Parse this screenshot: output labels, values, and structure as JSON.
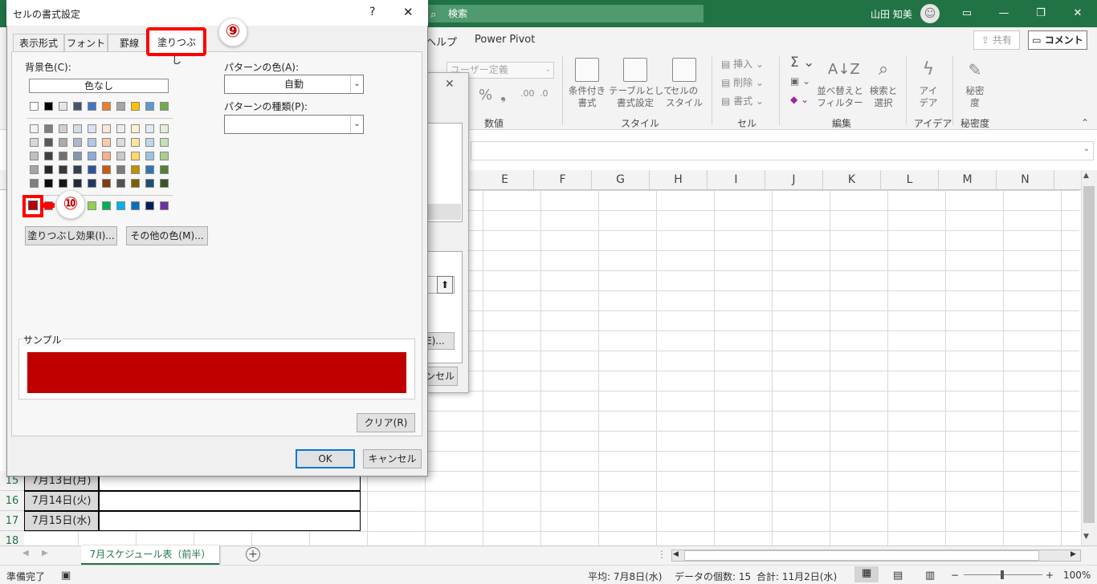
{
  "titlebar": {
    "search": "検索",
    "user": "山田 知美",
    "min": "—",
    "restore": "❐",
    "close": "✕",
    "ribbon_display": "▭"
  },
  "ribbon_tabs": {
    "help": "ヘルプ",
    "powerpivot": "Power Pivot"
  },
  "share": "共有",
  "comment": "コメント",
  "ribbon": {
    "numformat": "ユーザー定義",
    "number_group": "数値",
    "cond_format": "条件付き\n書式",
    "table_format": "テーブルとして\n書式設定",
    "cell_style": "セルの\nスタイル",
    "style_group": "スタイル",
    "insert": "挿入",
    "delete": "削除",
    "format": "書式",
    "cells_group": "セル",
    "sort_filter": "並べ替えと\nフィルター",
    "find_select": "検索と\n選択",
    "edit_group": "編集",
    "ideas": "アイ\nデア",
    "ideas_group": "アイデア",
    "sensitivity": "秘密\n度",
    "sensitivity_group": "秘密度"
  },
  "columns": [
    "E",
    "F",
    "G",
    "H",
    "I",
    "J",
    "K",
    "L",
    "M",
    "N"
  ],
  "rows": [
    {
      "num": "15",
      "date": "7月13日(月)"
    },
    {
      "num": "16",
      "date": "7月14日(火)"
    },
    {
      "num": "17",
      "date": "7月15日(水)"
    },
    {
      "num": "18",
      "date": ""
    }
  ],
  "sheet_tab": "7月スケジュール表（前半）",
  "status": {
    "ready": "準備完了",
    "avg": "平均: 7月8日(水)",
    "count": "データの個数: 15",
    "sum": "合計: 11月2日(水)",
    "zoom": "100%"
  },
  "bg_dialog": {
    "btn1": "E)...",
    "btn2": "ンセル"
  },
  "dialog": {
    "title": "セルの書式設定",
    "help": "?",
    "close": "✕",
    "tabs": [
      "表示形式",
      "フォント",
      "罫線",
      "塗りつぶし"
    ],
    "bg_color_label": "背景色(C):",
    "no_color": "色なし",
    "pattern_color_label": "パターンの色(A):",
    "pattern_color_value": "自動",
    "pattern_type_label": "パターンの種類(P):",
    "pattern_type_value": "",
    "fill_effects": "塗りつぶし効果(I)...",
    "more_colors": "その他の色(M)...",
    "sample_label": "サンプル",
    "sample_color": "#C00000",
    "clear": "クリア(R)",
    "ok": "OK",
    "cancel": "キャンセル",
    "theme_colors": [
      [
        "#FFFFFF",
        "#000000",
        "#E7E6E6",
        "#44546A",
        "#4472C4",
        "#ED7D31",
        "#A5A5A5",
        "#FFC000",
        "#5B9BD5",
        "#70AD47"
      ],
      [
        "#F2F2F2",
        "#7F7F7F",
        "#D0CECE",
        "#D6DCE4",
        "#D9E2F3",
        "#FBE5D5",
        "#EDEDED",
        "#FFF2CC",
        "#DEEBF6",
        "#E2EFD9"
      ],
      [
        "#D8D8D8",
        "#595959",
        "#AEABAB",
        "#ADB9CA",
        "#B4C6E7",
        "#F7CBAC",
        "#DBDBDB",
        "#FEE599",
        "#BDD7EE",
        "#C5E0B3"
      ],
      [
        "#BFBFBF",
        "#3F3F3F",
        "#757070",
        "#8496B0",
        "#8EAADB",
        "#F4B183",
        "#C9C9C9",
        "#FFD965",
        "#9DC3E6",
        "#A8D08D"
      ],
      [
        "#A5A5A5",
        "#262626",
        "#3A3838",
        "#323F4F",
        "#2F5496",
        "#C55A11",
        "#7B7B7B",
        "#BF9000",
        "#2E75B5",
        "#538135"
      ],
      [
        "#7F7F7F",
        "#0C0C0C",
        "#171616",
        "#222A35",
        "#1F3864",
        "#833C0B",
        "#525252",
        "#7F6000",
        "#1E4E79",
        "#375623"
      ]
    ],
    "standard_colors": [
      "#C00000",
      "#FF0000",
      "#FFC000",
      "#FFFF00",
      "#92D050",
      "#00B050",
      "#00B0F0",
      "#0070C0",
      "#002060",
      "#7030A0"
    ]
  },
  "callouts": {
    "step9": "⑨",
    "step10": "⑩"
  },
  "accent": "#217346",
  "highlight": "#FF0000"
}
